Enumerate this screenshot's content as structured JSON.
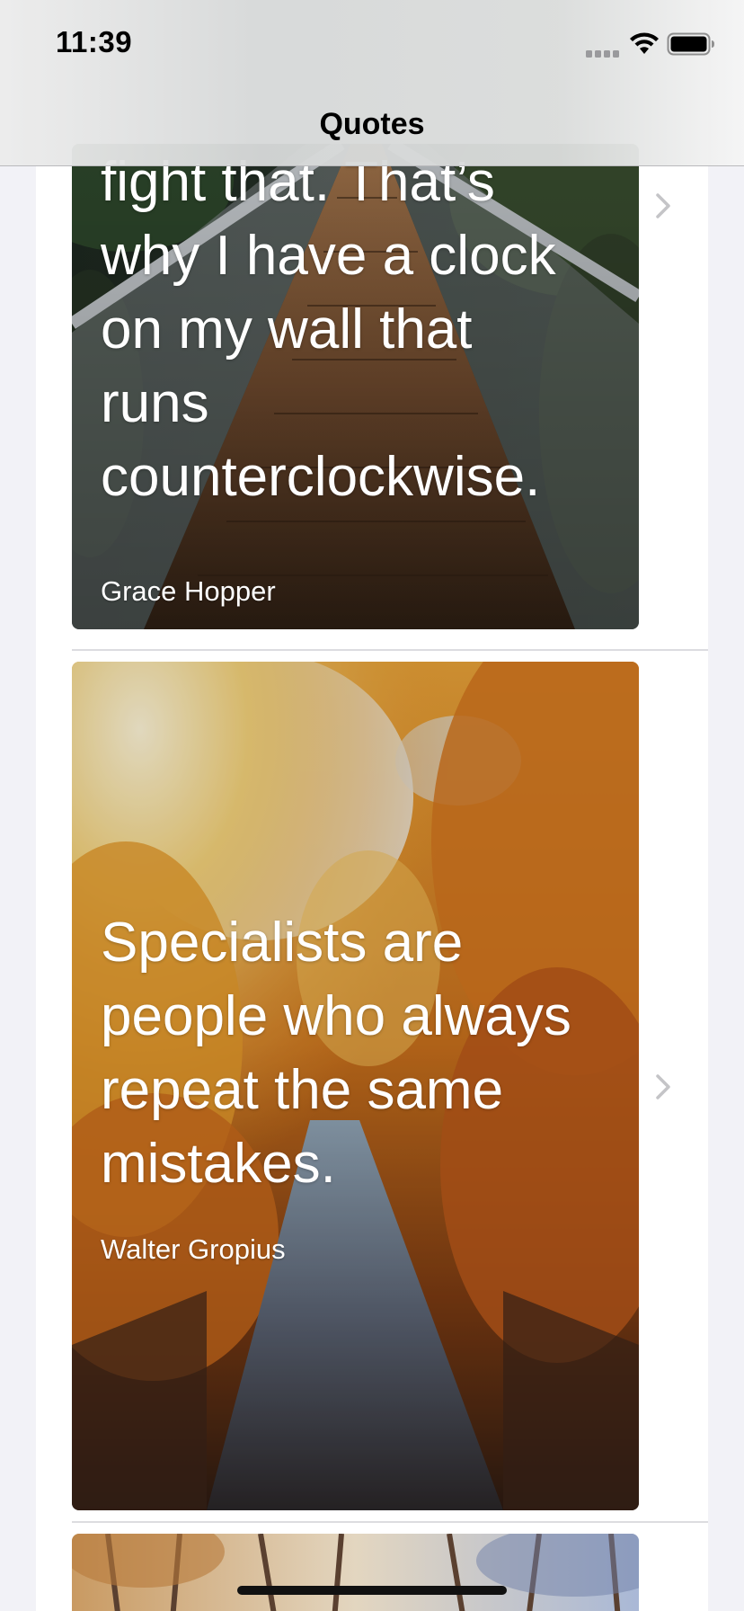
{
  "status_bar": {
    "time": "11:39"
  },
  "nav": {
    "title": "Quotes"
  },
  "quotes": [
    {
      "lines": [
        "fight that. That’s",
        "why I have a clock",
        "on my wall that",
        "runs",
        "counterclockwise."
      ],
      "author": "Grace Hopper",
      "image": "suspension-bridge-forest"
    },
    {
      "lines": [
        "Specialists are",
        "people who always",
        "repeat the same",
        "mistakes."
      ],
      "author": "Walter Gropius",
      "image": "autumn-forest-path"
    },
    {
      "lines": [],
      "author": "",
      "image": "bare-trees-sky"
    }
  ],
  "colors": {
    "background": "#f2f2f7",
    "cell": "#ffffff",
    "separator": "#dcdce0",
    "chevron": "#c4c4c7",
    "quote_text": "#ffffff"
  }
}
